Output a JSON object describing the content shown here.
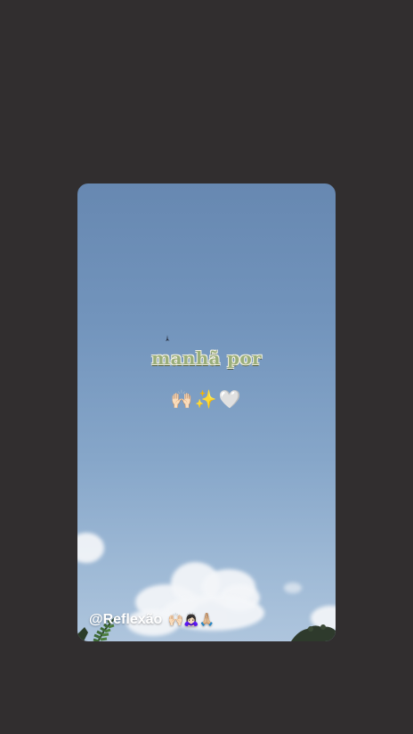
{
  "story": {
    "caption": "manhã por",
    "emojis": "🙌🏻✨🤍",
    "mention": "@Reflexão",
    "mention_emojis": "🙌🏻🙇🏻‍♀️🙏🏼"
  },
  "colors": {
    "background": "#312e2f",
    "sky_top": "#6788b1",
    "sky_bottom": "#aec5dd",
    "caption_fill": "#9aae7a",
    "caption_outline": "#f2f0e2"
  }
}
